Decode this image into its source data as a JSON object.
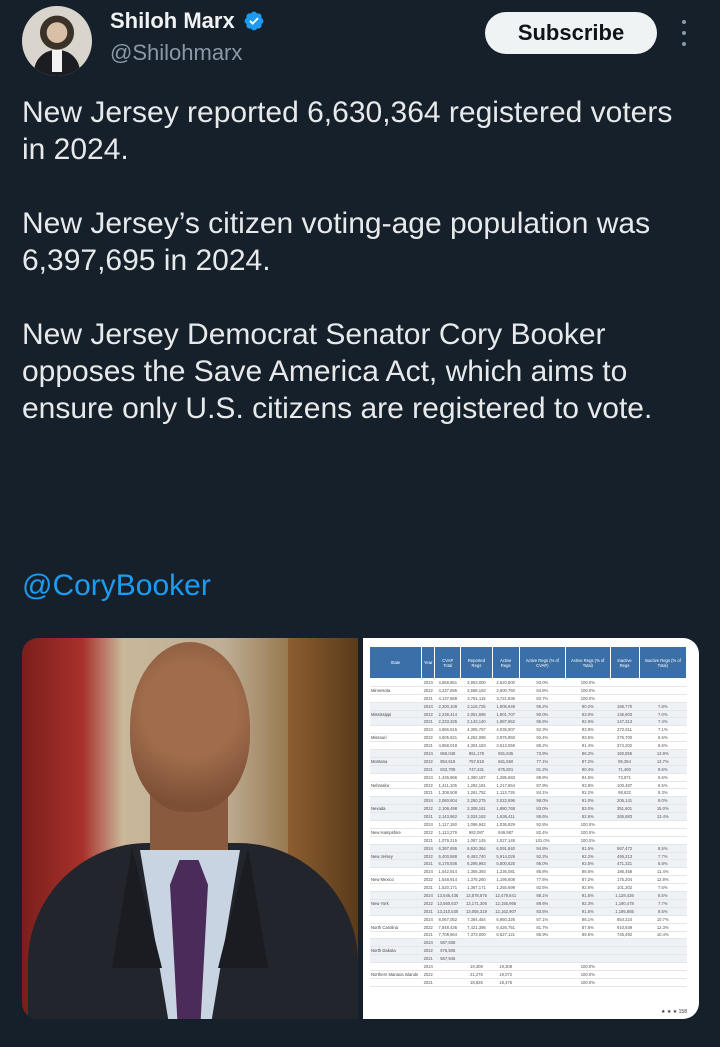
{
  "author": {
    "name": "Shiloh Marx",
    "handle": "@Shilohmarx",
    "verified": true,
    "verified_color": "#1d9bf0"
  },
  "actions": {
    "subscribe_label": "Subscribe",
    "more_icon": "more-vertical-icon"
  },
  "tweet": {
    "paragraphs": [
      "New Jersey reported 6,630,364 registered voters in 2024.",
      "New Jersey’s citizen voting-age population was 6,397,695 in 2024.",
      "New Jersey Democrat Senator Cory Booker opposes the Save America Act, which aims to ensure only U.S. citizens are registered to vote."
    ],
    "mention": "@CoryBooker",
    "mention_color": "#1d9bf0"
  },
  "media": {
    "table": {
      "headers": [
        "State",
        "Year",
        "CVAP Total",
        "Reported Regs",
        "Active Regs",
        "Active Regs (% of CVAP)",
        "Active Regs (% of Total)",
        "Inactive Regs",
        "Inactive Regs (% of Total)"
      ],
      "rows": [
        [
          "",
          "2024",
          "4,658,851",
          "3,953,000",
          "2,620,600",
          "93.0%",
          "100.0%",
          "",
          ""
        ],
        [
          "Minnesota",
          "2022",
          "4,237,895",
          "3,588,163",
          "2,600,750",
          "84.8%",
          "100.0%",
          "",
          ""
        ],
        [
          "",
          "2021",
          "4,137,888",
          "3,781,115",
          "3,721,836",
          "83.7%",
          "100.0%",
          "",
          ""
        ],
        [
          "",
          "2024",
          "2,200,109",
          "2,116,725",
          "1,905,649",
          "96.2%",
          "90.2%",
          "166,770",
          "7.8%"
        ],
        [
          "Mississippi",
          "2022",
          "2,236,414",
          "2,051,596",
          "1,901,707",
          "90.0%",
          "93.0%",
          "136,803",
          "7.0%"
        ],
        [
          "",
          "2021",
          "2,233,325",
          "2,143,140",
          "1,987,652",
          "95.5%",
          "92.6%",
          "147,313",
          "7.4%"
        ],
        [
          "",
          "2024",
          "4,666,815",
          "4,305,767",
          "4,035,907",
          "92.3%",
          "93.8%",
          "272,611",
          "7.1%"
        ],
        [
          "Missouri",
          "2022",
          "4,605,621",
          "4,252,096",
          "3,975,850",
          "92.4%",
          "93.5%",
          "276,700",
          "6.5%"
        ],
        [
          "",
          "2021",
          "4,658,018",
          "4,304,183",
          "3,613,059",
          "86.2%",
          "91.4%",
          "374,202",
          "8.6%"
        ],
        [
          "",
          "2024",
          "866,048",
          "851,178",
          "691,845",
          "73.9%",
          "86.2%",
          "160,855",
          "13.8%"
        ],
        [
          "Montana",
          "2022",
          "854,618",
          "757,818",
          "661,550",
          "77.1%",
          "87.2%",
          "95,354",
          "12.7%"
        ],
        [
          "",
          "2021",
          "833,709",
          "747,431",
          "675,801",
          "81.2%",
          "90.4%",
          "71,460",
          "9.6%"
        ],
        [
          "",
          "2024",
          "1,436,966",
          "1,360,187",
          "1,285,683",
          "89.8%",
          "94.5%",
          "73,871",
          "5.6%"
        ],
        [
          "Nebraska",
          "2022",
          "1,411,105",
          "1,292,181",
          "1,217,654",
          "87.9%",
          "93.8%",
          "100,487",
          "6.5%"
        ],
        [
          "",
          "2021",
          "1,308,508",
          "1,261,752",
          "1,113,726",
          "84.1%",
          "92.2%",
          "98,632",
          "8.3%"
        ],
        [
          "",
          "2024",
          "2,060,604",
          "2,250,275",
          "2,022,696",
          "98.0%",
          "91.0%",
          "206,141",
          "9.0%"
        ],
        [
          "Nevada",
          "2022",
          "2,108,498",
          "2,308,161",
          "1,880,768",
          "83.0%",
          "83.0%",
          "351,601",
          "15.0%"
        ],
        [
          "",
          "2021",
          "2,143,962",
          "2,024,162",
          "1,636,411",
          "86.6%",
          "82.6%",
          "265,883",
          "13.4%"
        ],
        [
          "",
          "2024",
          "1,117,150",
          "1,096,942",
          "1,036,829",
          "92.8%",
          "100.0%",
          "",
          ""
        ],
        [
          "New Hampshire",
          "2022",
          "1,113,279",
          "982,087",
          "949,987",
          "82.4%",
          "100.0%",
          "",
          ""
        ],
        [
          "",
          "2021",
          "1,079,215",
          "1,087,145",
          "1,027,145",
          "101.0%",
          "100.0%",
          "",
          ""
        ],
        [
          "",
          "2024",
          "6,397,695",
          "6,630,364",
          "6,091,840",
          "94.8%",
          "91.5%",
          "567,472",
          "8.5%"
        ],
        [
          "New Jersey",
          "2022",
          "6,400,688",
          "6,463,740",
          "5,914,029",
          "92.2%",
          "92.2%",
          "495,213",
          "7.7%"
        ],
        [
          "",
          "2021",
          "6,178,936",
          "6,295,963",
          "5,800,625",
          "95.0%",
          "92.5%",
          "471,321",
          "6.8%"
        ],
        [
          "",
          "2024",
          "1,542,914",
          "1,355,393",
          "1,236,081",
          "85.8%",
          "88.6%",
          "186,458",
          "11.4%"
        ],
        [
          "New Mexico",
          "2022",
          "1,548,914",
          "1,375,260",
          "1,195,608",
          "77.6%",
          "87.2%",
          "175,204",
          "12.8%"
        ],
        [
          "",
          "2021",
          "1,520,171",
          "1,367,171",
          "1,255,699",
          "82.5%",
          "92.5%",
          "101,202",
          "7.5%"
        ],
        [
          "",
          "2024",
          "13,545,436",
          "13,578,675",
          "12,478,641",
          "88.1%",
          "91.5%",
          "1,128,426",
          "8.5%"
        ],
        [
          "New York",
          "2022",
          "13,560,637",
          "13,171,306",
          "12,155,965",
          "89.6%",
          "92.3%",
          "1,190,478",
          "7.7%"
        ],
        [
          "",
          "2021",
          "13,310,530",
          "13,055,319",
          "12,162,907",
          "83.5%",
          "91.5%",
          "1,195,665",
          "8.5%"
        ],
        [
          "",
          "2024",
          "8,067,052",
          "7,384,454",
          "6,950,326",
          "87.1%",
          "86.1%",
          "854,224",
          "10.7%"
        ],
        [
          "North Carolina",
          "2022",
          "7,848,436",
          "7,421,395",
          "6,426,751",
          "81.7%",
          "87.6%",
          "910,849",
          "12.3%"
        ],
        [
          "",
          "2021",
          "7,708,664",
          "7,373,000",
          "6,627,121",
          "85.9%",
          "89.6%",
          "745,492",
          "10.4%"
        ],
        [
          "",
          "2024",
          "587,838",
          "",
          "",
          "",
          "",
          "",
          ""
        ],
        [
          "North Dakota",
          "2022",
          "576,505",
          "",
          "",
          "",
          "",
          "",
          ""
        ],
        [
          "",
          "2021",
          "567,945",
          "",
          "",
          "",
          "",
          "",
          ""
        ],
        [
          "",
          "2024",
          "",
          "19,308",
          "19,308",
          "",
          "100.0%",
          "",
          ""
        ],
        [
          "Northern Mariana Islands",
          "2022",
          "",
          "21,276",
          "19,072",
          "",
          "100.0%",
          "",
          ""
        ],
        [
          "",
          "2021",
          "",
          "18,826",
          "18,476",
          "",
          "100.0%",
          "",
          ""
        ]
      ],
      "footer": "★ ★ ★  158"
    }
  }
}
